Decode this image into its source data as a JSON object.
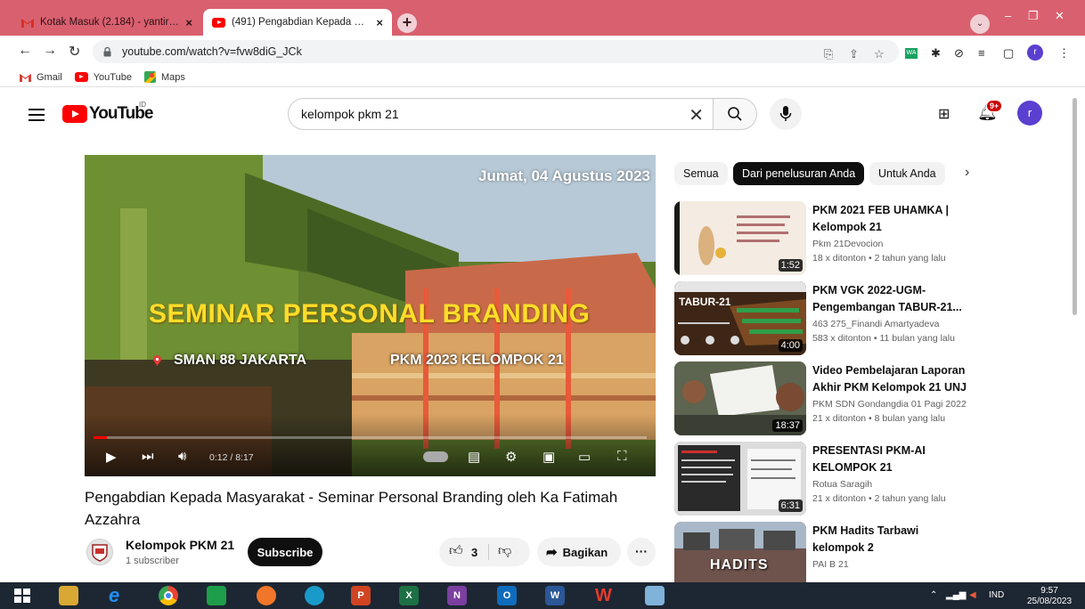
{
  "browser": {
    "tabs": [
      {
        "title": "Kotak Masuk (2.184) - yantirisda7",
        "favicon": "gmail-icon",
        "active": false
      },
      {
        "title": "(491) Pengabdian Kepada Masyar",
        "favicon": "youtube-icon",
        "active": true
      }
    ],
    "new_tab_label": "+",
    "close_label": "×",
    "url": "youtube.com/watch?v=fvw8diG_JCk",
    "bookmarks": [
      {
        "label": "Gmail",
        "icon": "gmail-icon"
      },
      {
        "label": "YouTube",
        "icon": "youtube-icon"
      },
      {
        "label": "Maps",
        "icon": "maps-icon"
      }
    ],
    "profile_initial": "r"
  },
  "youtube": {
    "logo_text": "YouTube",
    "country_code": "ID",
    "search_query": "kelompok pkm 21",
    "notification_badge": "9+",
    "avatar_initial": "r",
    "accent": "#ff0000"
  },
  "player": {
    "overlay_date": "Jumat, 04 Agustus 2023",
    "overlay_title": "SEMINAR PERSONAL BRANDING",
    "overlay_location": "SMAN 88 JAKARTA",
    "overlay_group": "PKM 2023 KELOMPOK 21",
    "time": "0:12 / 8:17",
    "progress_fraction": 0.024
  },
  "video": {
    "title": "Pengabdian Kepada Masyarakat - Seminar Personal Branding oleh Ka Fatimah Azzahra",
    "channel": "Kelompok PKM 21",
    "subscribers": "1 subscriber",
    "subscribe_label": "Subscribe",
    "likes": "3",
    "share_label": "Bagikan",
    "more_label": "···"
  },
  "chips": [
    "Semua",
    "Dari penelusuran Anda",
    "Untuk Anda"
  ],
  "related": [
    {
      "title": "PKM 2021 FEB UHAMKA | Kelompok 21",
      "channel": "Pkm 21Devocion",
      "meta": "18 x ditonton • 2 tahun yang lalu",
      "duration": "1:52",
      "color": "#f1e6dd"
    },
    {
      "title": "PKM VGK 2022-UGM-Pengembangan TABUR-21...",
      "channel": "463 275_Finandi Amartyadeva",
      "meta": "583 x ditonton • 11 bulan yang lalu",
      "duration": "4:00",
      "color": "#4a2d1a",
      "label": "TABUR-21"
    },
    {
      "title": "Video Pembelajaran Laporan Akhir PKM Kelompok 21 UNJ",
      "channel": "PKM SDN Gondangdia 01 Pagi 2022",
      "meta": "21 x ditonton • 8 bulan yang lalu",
      "duration": "18:37",
      "color": "#6b6f5a"
    },
    {
      "title": "PRESENTASI PKM-AI KELOMPOK 21",
      "channel": "Rotua Saragih",
      "meta": "21 x ditonton • 2 tahun yang lalu",
      "duration": "6:31",
      "color": "#2e2e2e"
    },
    {
      "title": "PKM Hadits Tarbawi kelompok 2",
      "channel": "PAI B 21",
      "meta": "",
      "duration": "",
      "color": "#7a5d58",
      "label": "HADITS"
    }
  ],
  "taskbar": {
    "language": "IND",
    "time": "9:57",
    "date": "25/08/2023"
  }
}
